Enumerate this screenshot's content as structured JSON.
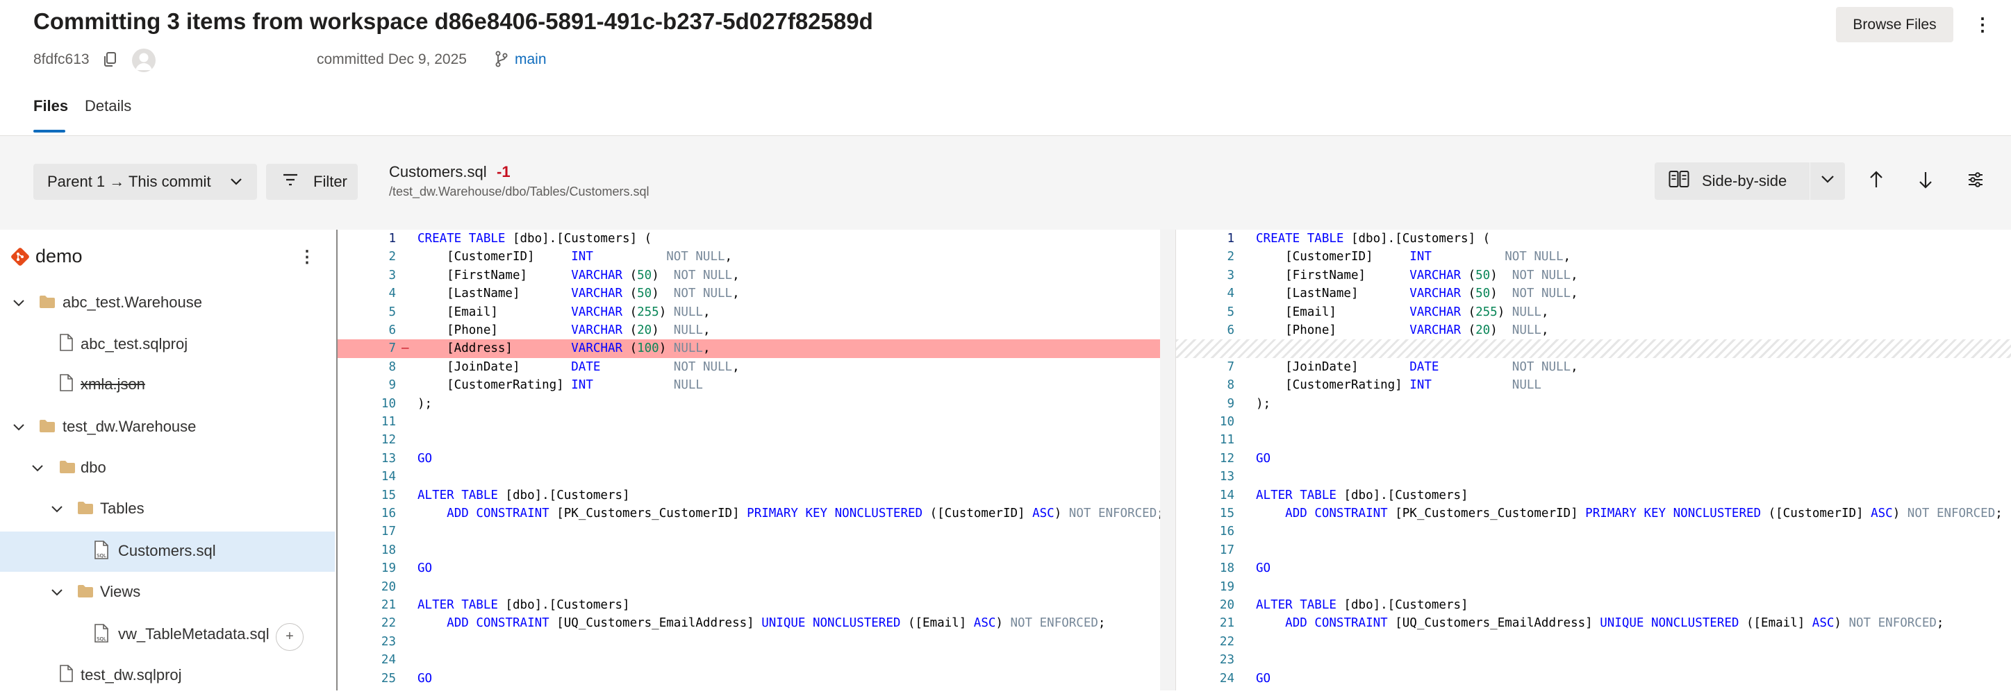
{
  "header": {
    "title": "Committing 3 items from workspace d86e8406-5891-491c-b237-5d027f82589d",
    "commit_hash": "8fdfc613",
    "committed_text": "committed Dec 9, 2025",
    "branch": "main",
    "browse_files_label": "Browse Files",
    "more_label": "⋮"
  },
  "tabs": [
    {
      "label": "Files",
      "selected": true
    },
    {
      "label": "Details",
      "selected": false
    }
  ],
  "toolbar": {
    "parent_label": "Parent 1 → This commit",
    "filter_label": "Filter",
    "file_name": "Customers.sql",
    "file_change": "-1",
    "file_path": "/test_dw.Warehouse/dbo/Tables/Customers.sql",
    "view_mode_label": "Side-by-side"
  },
  "sidebar": {
    "root": "demo",
    "more_label": "⋮",
    "tree": [
      {
        "label": "abc_test.Warehouse",
        "kind": "folder",
        "expanded": true
      },
      {
        "label": "abc_test.sqlproj",
        "kind": "file"
      },
      {
        "label": "xmla.json",
        "kind": "file",
        "deleted": true
      },
      {
        "label": "test_dw.Warehouse",
        "kind": "folder",
        "expanded": true
      },
      {
        "label": "dbo",
        "kind": "folder",
        "expanded": true
      },
      {
        "label": "Tables",
        "kind": "folder",
        "expanded": true
      },
      {
        "label": "Customers.sql",
        "kind": "sqlfile",
        "selected": true
      },
      {
        "label": "Views",
        "kind": "folder",
        "expanded": true
      },
      {
        "label": "vw_TableMetadata.sql",
        "kind": "sqlfile"
      },
      {
        "label": "test_dw.sqlproj",
        "kind": "file"
      }
    ],
    "add_badge": "+"
  },
  "diff": {
    "left": [
      {
        "n": "1",
        "code": "CREATE TABLE [dbo].[Customers] ("
      },
      {
        "n": "2",
        "code": "    [CustomerID]     INT          NOT NULL,"
      },
      {
        "n": "3",
        "code": "    [FirstName]      VARCHAR (50)  NOT NULL,"
      },
      {
        "n": "4",
        "code": "    [LastName]       VARCHAR (50)  NOT NULL,"
      },
      {
        "n": "5",
        "code": "    [Email]          VARCHAR (255) NULL,"
      },
      {
        "n": "6",
        "code": "    [Phone]          VARCHAR (20)  NULL,"
      },
      {
        "n": "7",
        "code": "    [Address]        VARCHAR (100) NULL,",
        "deleted": true,
        "marker": "—"
      },
      {
        "n": "8",
        "code": "    [JoinDate]       DATE          NOT NULL,"
      },
      {
        "n": "9",
        "code": "    [CustomerRating] INT           NULL"
      },
      {
        "n": "10",
        "code": ");"
      },
      {
        "n": "11",
        "code": ""
      },
      {
        "n": "12",
        "code": ""
      },
      {
        "n": "13",
        "code": "GO"
      },
      {
        "n": "14",
        "code": ""
      },
      {
        "n": "15",
        "code": "ALTER TABLE [dbo].[Customers]"
      },
      {
        "n": "16",
        "code": "    ADD CONSTRAINT [PK_Customers_CustomerID] PRIMARY KEY NONCLUSTERED ([CustomerID] ASC) NOT ENFORCED;"
      },
      {
        "n": "17",
        "code": ""
      },
      {
        "n": "18",
        "code": ""
      },
      {
        "n": "19",
        "code": "GO"
      },
      {
        "n": "20",
        "code": ""
      },
      {
        "n": "21",
        "code": "ALTER TABLE [dbo].[Customers]"
      },
      {
        "n": "22",
        "code": "    ADD CONSTRAINT [UQ_Customers_EmailAddress] UNIQUE NONCLUSTERED ([Email] ASC) NOT ENFORCED;"
      },
      {
        "n": "23",
        "code": ""
      },
      {
        "n": "24",
        "code": ""
      },
      {
        "n": "25",
        "code": "GO"
      }
    ],
    "right": [
      {
        "n": "1",
        "code": "CREATE TABLE [dbo].[Customers] ("
      },
      {
        "n": "2",
        "code": "    [CustomerID]     INT          NOT NULL,"
      },
      {
        "n": "3",
        "code": "    [FirstName]      VARCHAR (50)  NOT NULL,"
      },
      {
        "n": "4",
        "code": "    [LastName]       VARCHAR (50)  NOT NULL,"
      },
      {
        "n": "5",
        "code": "    [Email]          VARCHAR (255) NULL,"
      },
      {
        "n": "6",
        "code": "    [Phone]          VARCHAR (20)  NULL,"
      },
      {
        "n": "",
        "code": "",
        "placeholder": true
      },
      {
        "n": "7",
        "code": "    [JoinDate]       DATE          NOT NULL,"
      },
      {
        "n": "8",
        "code": "    [CustomerRating] INT           NULL"
      },
      {
        "n": "9",
        "code": ");"
      },
      {
        "n": "10",
        "code": ""
      },
      {
        "n": "11",
        "code": ""
      },
      {
        "n": "12",
        "code": "GO"
      },
      {
        "n": "13",
        "code": ""
      },
      {
        "n": "14",
        "code": "ALTER TABLE [dbo].[Customers]"
      },
      {
        "n": "15",
        "code": "    ADD CONSTRAINT [PK_Customers_CustomerID] PRIMARY KEY NONCLUSTERED ([CustomerID] ASC) NOT ENFORCED;"
      },
      {
        "n": "16",
        "code": ""
      },
      {
        "n": "17",
        "code": ""
      },
      {
        "n": "18",
        "code": "GO"
      },
      {
        "n": "19",
        "code": ""
      },
      {
        "n": "20",
        "code": "ALTER TABLE [dbo].[Customers]"
      },
      {
        "n": "21",
        "code": "    ADD CONSTRAINT [UQ_Customers_EmailAddress] UNIQUE NONCLUSTERED ([Email] ASC) NOT ENFORCED;"
      },
      {
        "n": "22",
        "code": ""
      },
      {
        "n": "23",
        "code": ""
      },
      {
        "n": "24",
        "code": "GO"
      }
    ]
  },
  "colors": {
    "accent": "#0f6cbd",
    "deleted_line": "#ffa5a5",
    "delete_count": "#c50f1f",
    "keyword": "#0000ff",
    "number": "#098658",
    "line_number": "#237893"
  }
}
